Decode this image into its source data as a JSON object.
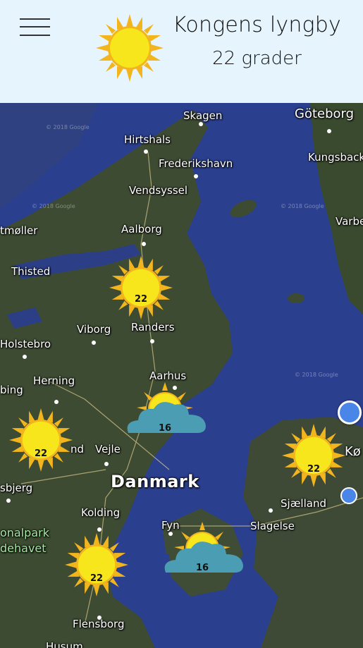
{
  "header": {
    "menu_icon": "hamburger-menu-icon",
    "weather_icon": "sun-icon",
    "city": "Kongens lyngby",
    "temperature_text": "22 grader"
  },
  "map": {
    "country_label": "Danmark",
    "places": {
      "skagen": "Skagen",
      "goteborg": "Göteborg",
      "hirtshals": "Hirtshals",
      "frederikshavn": "Frederikshavn",
      "kungsbacka": "Kungsback",
      "vendsyssel": "Vendsyssel",
      "tmoller": "tmøller",
      "aalborg": "Aalborg",
      "varberg": "Varbe",
      "thisted": "Thisted",
      "viborg": "Viborg",
      "randers": "Randers",
      "holstebro": "Holstebro",
      "aarhus": "Aarhus",
      "herning": "Herning",
      "bing": "bing",
      "vejle": "Vejle",
      "nd": "nd",
      "kob": "Kø",
      "sbjerg": "sbjerg",
      "kolding": "Kolding",
      "sjaelland": "Sjælland",
      "fyn": "Fyn",
      "slagelse": "Slagelse",
      "onalpark": "onalpark",
      "dehavet": "dehavet",
      "flensborg": "Flensborg",
      "husum": "Husum"
    },
    "watermarks": [
      "© 2018 Google",
      "© 2018 Google",
      "© 2018 Google",
      "© 2018 Google"
    ],
    "markers": [
      {
        "id": "aalborg",
        "icon": "sun-icon",
        "temp": "22"
      },
      {
        "id": "aarhus",
        "icon": "partly-cloudy-icon",
        "temp": "16"
      },
      {
        "id": "herning",
        "icon": "sun-icon",
        "temp": "22"
      },
      {
        "id": "copenhagen",
        "icon": "sun-icon",
        "temp": "22"
      },
      {
        "id": "kolding",
        "icon": "sun-icon",
        "temp": "22"
      },
      {
        "id": "fyn",
        "icon": "partly-cloudy-icon",
        "temp": "16"
      }
    ]
  },
  "colors": {
    "header_bg": "#e6f5fd",
    "sea": "#2b3f8f",
    "land": "#3d4a35",
    "sun": "#f7e61c",
    "sun_rays": "#f2b51d",
    "cloud": "#4b9db3",
    "location_dot": "#4a86e8"
  }
}
